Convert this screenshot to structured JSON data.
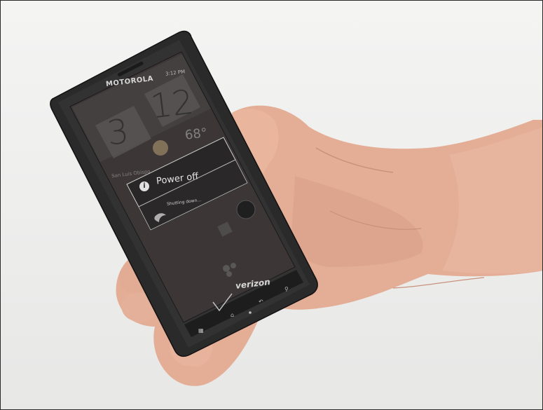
{
  "image": {
    "background_color": "#ffffff",
    "frame_border_color": "#2a2a2a",
    "scene": "hand holding smartphone showing power off dialog"
  },
  "phone": {
    "brand": "MOTOROLA",
    "carrier": "verizon",
    "status_time": "3:12 PM",
    "clock_digit_left": "3",
    "clock_digit_right": "12",
    "temperature": "68°",
    "city": "San Luis Obispo",
    "dialog_title": "Power off",
    "dialog_message": "Shutting down...",
    "icons": [
      "info-icon",
      "facebook-icon",
      "phone-icon",
      "contacts-icon",
      "search-icon",
      "menu-icon",
      "home-icon",
      "back-icon"
    ],
    "body_color": "#2b2b2b",
    "screen_color": "#3a3535"
  },
  "hand": {
    "skin_color": "#e7b39b",
    "shadow_color": "#c98e78"
  }
}
